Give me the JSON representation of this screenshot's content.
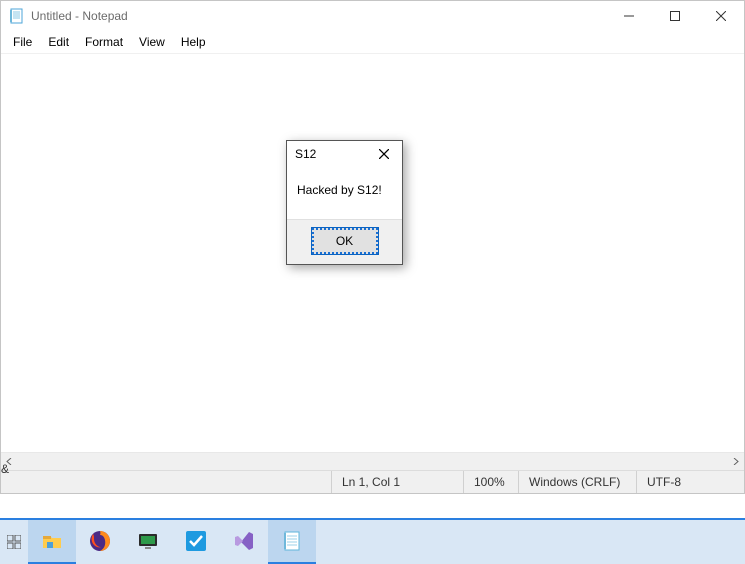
{
  "window": {
    "title": "Untitled - Notepad"
  },
  "menu": {
    "file": "File",
    "edit": "Edit",
    "format": "Format",
    "view": "View",
    "help": "Help"
  },
  "status": {
    "position": "Ln 1, Col 1",
    "zoom": "100%",
    "eol": "Windows (CRLF)",
    "encoding": "UTF-8"
  },
  "dialog": {
    "title": "S12",
    "message": "Hacked by S12!",
    "ok": "OK"
  },
  "misc": {
    "edge_char": "&"
  }
}
